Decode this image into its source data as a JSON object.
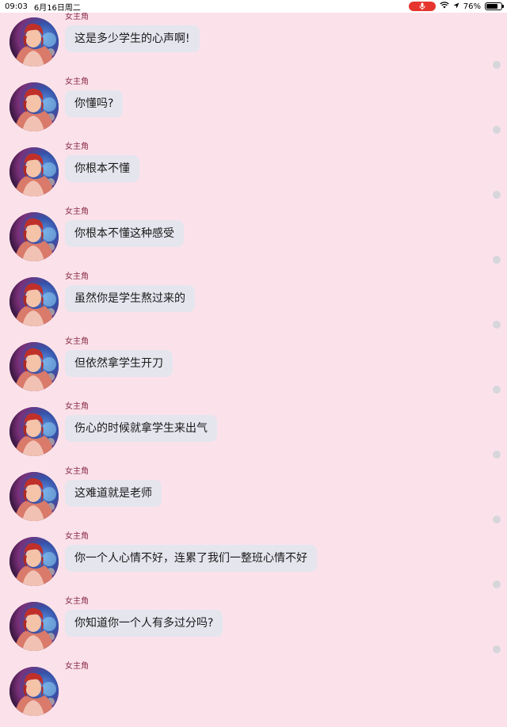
{
  "status_bar": {
    "time": "09:03",
    "date": "6月16日周二",
    "battery_text": "76%",
    "battery_level": 0.76,
    "mic_color": "#e5352e"
  },
  "chat": {
    "bubble_color": "#e5e5ee",
    "background_color": "#fbe2ea",
    "messages": [
      {
        "sender": "女主角",
        "text": "这是多少学生的心声啊!"
      },
      {
        "sender": "女主角",
        "text": "你懂吗?"
      },
      {
        "sender": "女主角",
        "text": "你根本不懂"
      },
      {
        "sender": "女主角",
        "text": "你根本不懂这种感受"
      },
      {
        "sender": "女主角",
        "text": "虽然你是学生熬过来的"
      },
      {
        "sender": "女主角",
        "text": "但依然拿学生开刀"
      },
      {
        "sender": "女主角",
        "text": "伤心的时候就拿学生来出气"
      },
      {
        "sender": "女主角",
        "text": "这难道就是老师"
      },
      {
        "sender": "女主角",
        "text": "你一个人心情不好，连累了我们一整班心情不好"
      },
      {
        "sender": "女主角",
        "text": "你知道你一个人有多过分吗?"
      },
      {
        "sender": "女主角",
        "text": ""
      }
    ]
  }
}
